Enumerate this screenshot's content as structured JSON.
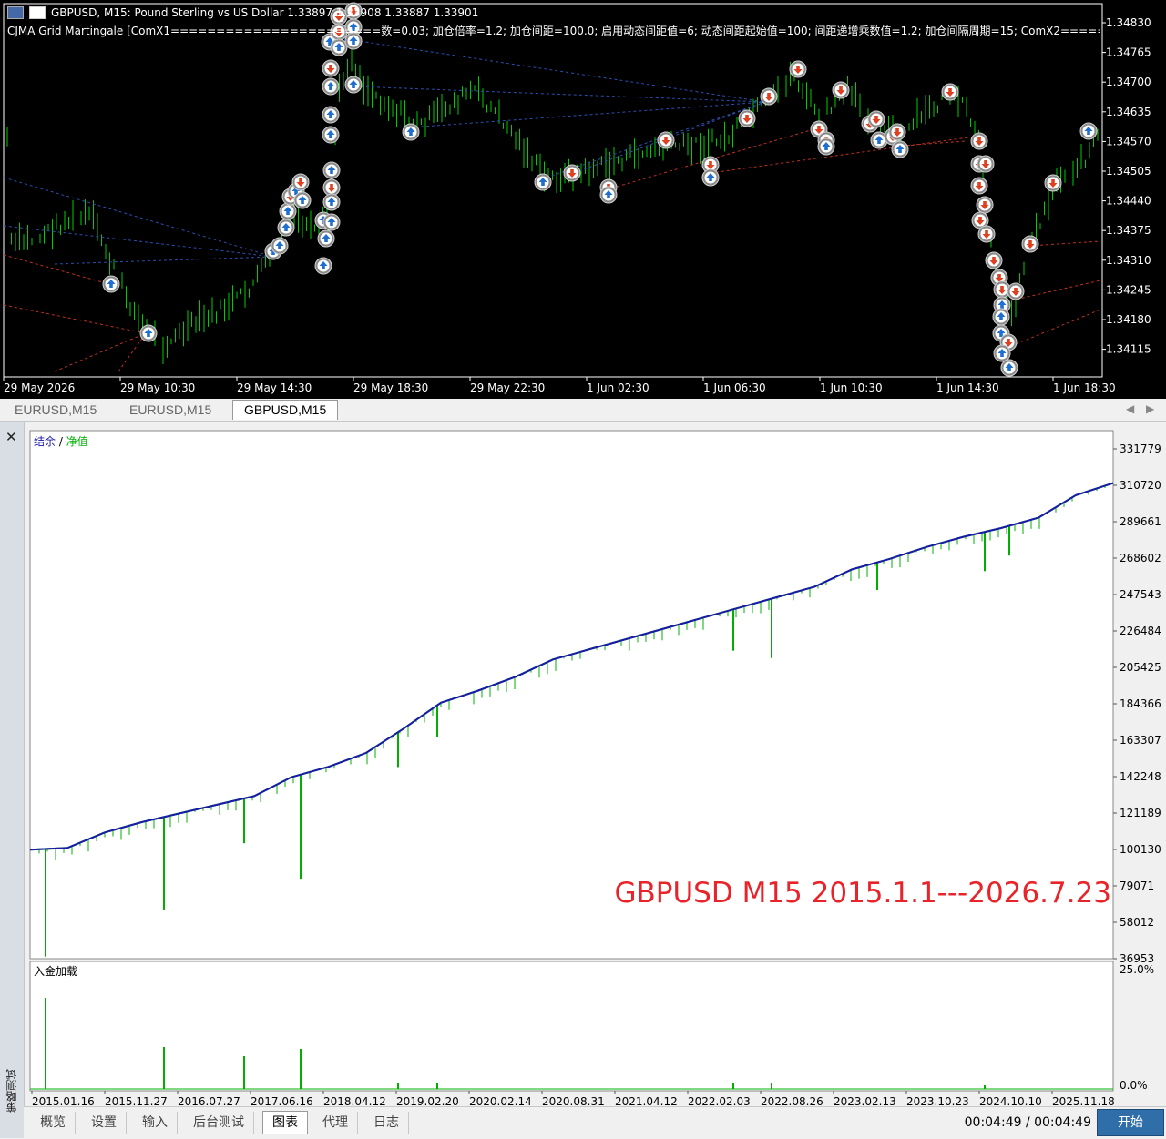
{
  "chart_window": {
    "symbol_line": "GBPUSD, M15:  Pound Sterling vs US Dollar  1.33897  1.33908  1.33887  1.33901",
    "ea_line": "CJMA Grid Martingale [ComX1=======================数=0.03; 加仓倍率=1.2; 加仓间距=100.0; 启用动态间距值=6; 动态间距起始值=100; 间距递增乘数值=1.2; 加仓间隔周期=15; ComX2==========",
    "price_ticks": [
      "1.34830",
      "1.34765",
      "1.34700",
      "1.34635",
      "1.34570",
      "1.34505",
      "1.34440",
      "1.34375",
      "1.34310",
      "1.34245",
      "1.34180",
      "1.34115"
    ],
    "time_ticks": [
      "29 May 2026",
      "29 May 10:30",
      "29 May 14:30",
      "29 May 18:30",
      "29 May 22:30",
      "1 Jun 02:30",
      "1 Jun 06:30",
      "1 Jun 10:30",
      "1 Jun 14:30",
      "1 Jun 18:30"
    ],
    "candle_color": "#00cc00",
    "buy_color": "#1e6fd0",
    "sell_color": "#e04020"
  },
  "chart_tabs": [
    {
      "label": "EURUSD,M15",
      "active": false
    },
    {
      "label": "EURUSD,M15",
      "active": false
    },
    {
      "label": "GBPUSD,M15",
      "active": true
    }
  ],
  "tester": {
    "close_label": "✕",
    "side_label": "策略测试",
    "legend_balance": "结余",
    "legend_sep": " / ",
    "legend_equity": "净值",
    "deposit_label": "入金加载",
    "watermark": "GBPUSD M15 2015.1.1---2026.7.23",
    "bottom_tabs": [
      "概览",
      "设置",
      "输入",
      "后台测试",
      "图表",
      "代理",
      "日志"
    ],
    "active_bottom_tab": "图表",
    "timer": "00:04:49 / 00:04:49",
    "start_label": "开始"
  },
  "chart_data": {
    "type": "line",
    "y_ticks": [
      "331779",
      "310720",
      "289661",
      "268602",
      "247543",
      "226484",
      "205425",
      "184366",
      "163307",
      "142248",
      "121189",
      "100130",
      "79071",
      "58012",
      "36953"
    ],
    "ylim": [
      36953,
      331779
    ],
    "x_ticks": [
      "2015.01.16",
      "2015.11.27",
      "2016.07.27",
      "2017.06.16",
      "2018.04.12",
      "2019.02.20",
      "2020.02.14",
      "2020.08.31",
      "2021.04.12",
      "2022.02.03",
      "2022.08.26",
      "2023.02.13",
      "2023.10.23",
      "2024.10.10",
      "2025.11.18"
    ],
    "balance_color": "#1a1aa8",
    "equity_color": "#00b000",
    "series": [
      {
        "name": "结余",
        "values": [
          100000,
          101000,
          110000,
          116000,
          121000,
          126000,
          131000,
          142000,
          148000,
          156000,
          170000,
          185000,
          192000,
          200000,
          210000,
          216000,
          222000,
          228000,
          234000,
          240000,
          246000,
          252000,
          262000,
          268000,
          275000,
          281000,
          286000,
          292000,
          305000,
          312000
        ]
      },
      {
        "name": "净值",
        "values": [
          100000,
          101000,
          110000,
          116000,
          121000,
          126000,
          131000,
          142000,
          148000,
          156000,
          170000,
          185000,
          192000,
          200000,
          210000,
          216000,
          222000,
          228000,
          234000,
          240000,
          246000,
          252000,
          262000,
          268000,
          275000,
          281000,
          286000,
          292000,
          305000,
          312000
        ]
      }
    ],
    "deposit_ylim": [
      "25.0%",
      "0.0%"
    ]
  }
}
